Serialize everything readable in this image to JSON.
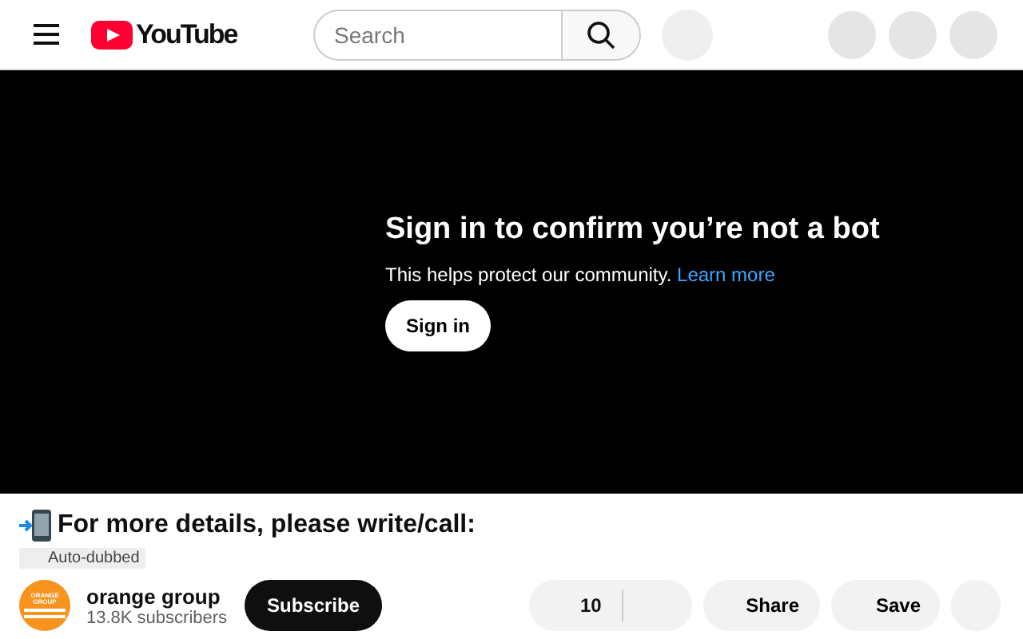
{
  "header": {
    "logo_text": "YouTube",
    "search": {
      "placeholder": "Search"
    }
  },
  "player": {
    "heading": "Sign in to confirm you’re not a bot",
    "message": "This helps protect our community.",
    "link": "Learn more",
    "button": "Sign in"
  },
  "video": {
    "title": "For more details, please write/call:",
    "badge": "Auto-dubbed",
    "channel": {
      "avatar_text": "ORANGE GROUP",
      "name": "orange group",
      "subscribers": "13.8K subscribers"
    },
    "subscribe": "Subscribe",
    "likes": "10",
    "share": "Share",
    "save": "Save"
  }
}
